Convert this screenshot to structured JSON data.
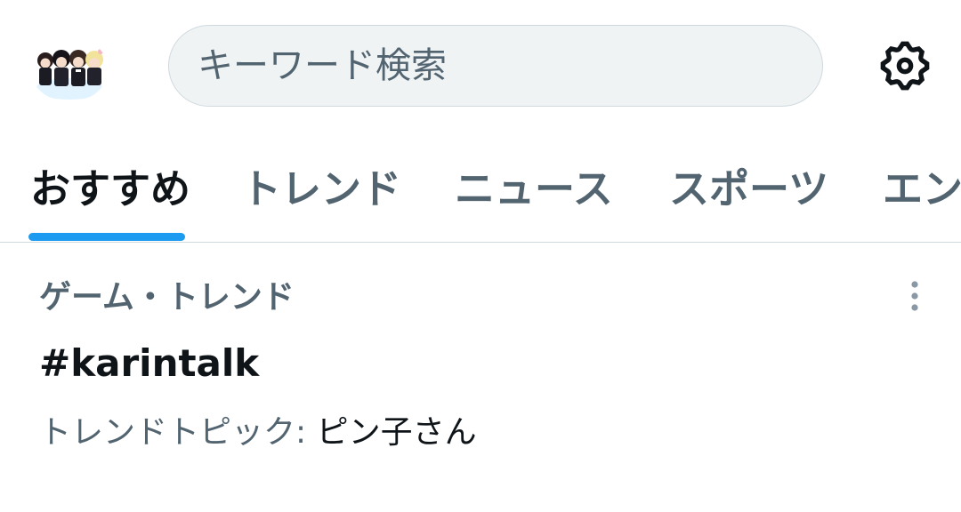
{
  "header": {
    "avatar_icon": "profile-avatar-icon",
    "search": {
      "placeholder": "キーワード検索",
      "value": ""
    },
    "settings_icon": "gear-icon"
  },
  "tabs": [
    {
      "label": "おすすめ",
      "active": true
    },
    {
      "label": "トレンド",
      "active": false
    },
    {
      "label": "ニュース",
      "active": false
    },
    {
      "label": "スポーツ",
      "active": false
    },
    {
      "label": "エンタメ",
      "active": false
    }
  ],
  "trend": {
    "context": "ゲーム・トレンド",
    "name": "#karintalk",
    "topic_label": "トレンドトピック: ",
    "topic_value": "ピン子さん",
    "more_icon": "more-vertical-icon"
  },
  "colors": {
    "accent": "#1d9bf0",
    "text_primary": "#0f1419",
    "text_secondary": "#536471",
    "border": "#cfd9de",
    "search_bg": "#eff3f4"
  }
}
